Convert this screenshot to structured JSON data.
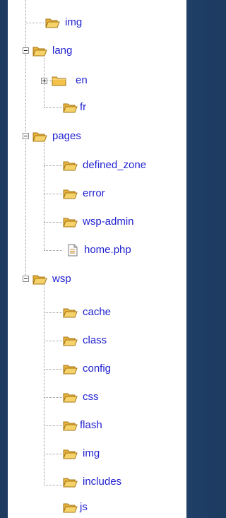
{
  "tree": {
    "items": [
      {
        "label": "img",
        "type": "folder-open"
      },
      {
        "label": "lang",
        "type": "folder-open",
        "toggle": "expanded"
      },
      {
        "label": "en",
        "type": "folder-closed",
        "toggle": "collapsed"
      },
      {
        "label": "fr",
        "type": "folder-open"
      },
      {
        "label": "pages",
        "type": "folder-open",
        "toggle": "expanded"
      },
      {
        "label": "defined_zone",
        "type": "folder-open"
      },
      {
        "label": "error",
        "type": "folder-open"
      },
      {
        "label": "wsp-admin",
        "type": "folder-open"
      },
      {
        "label": "home.php",
        "type": "file"
      },
      {
        "label": "wsp",
        "type": "folder-open",
        "toggle": "expanded"
      },
      {
        "label": "cache",
        "type": "folder-open"
      },
      {
        "label": "class",
        "type": "folder-open"
      },
      {
        "label": "config",
        "type": "folder-open"
      },
      {
        "label": "css",
        "type": "folder-open"
      },
      {
        "label": "flash",
        "type": "folder-open"
      },
      {
        "label": "img",
        "type": "folder-open"
      },
      {
        "label": "includes",
        "type": "folder-open"
      },
      {
        "label": "js",
        "type": "folder-open"
      }
    ]
  },
  "colors": {
    "label": "#1f1fd0",
    "folder": "#f3c24b",
    "folder_edge": "#b07d1a",
    "background": "#244a76"
  }
}
